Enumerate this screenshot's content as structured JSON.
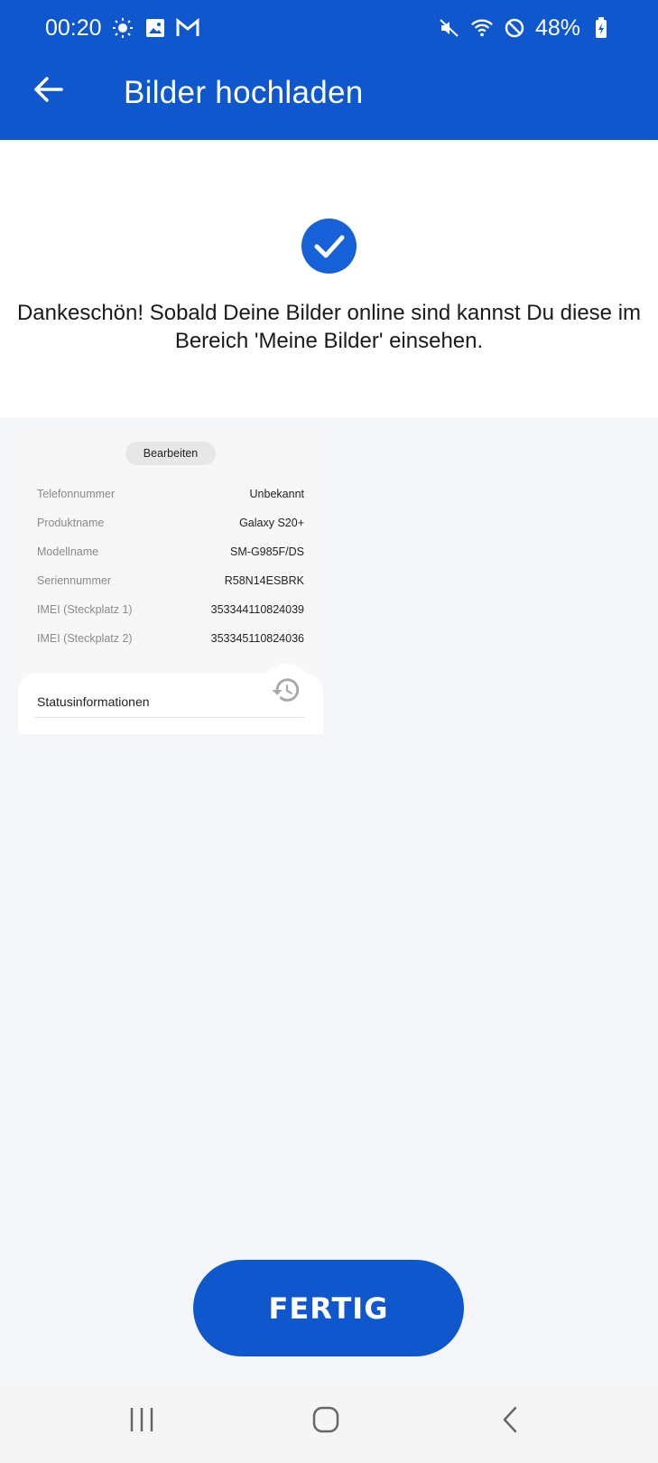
{
  "status_bar": {
    "time": "00:20",
    "battery": "48%",
    "icons": [
      "brightness-icon",
      "image-icon",
      "gmail-icon",
      "mute-icon",
      "wifi-icon",
      "dnd-icon",
      "battery-icon"
    ]
  },
  "header": {
    "title": "Bilder hochladen",
    "back_icon": "arrow-left-icon",
    "background": "#0f57cc"
  },
  "success": {
    "icon": "check-circle-icon",
    "message": "Dankeschön! Sobald Deine Bilder online sind kannst Du diese im Bereich 'Meine Bilder' einsehen."
  },
  "preview": {
    "edit_label": "Bearbeiten",
    "rows": [
      {
        "label": "Telefonnummer",
        "value": "Unbekannt"
      },
      {
        "label": "Produktname",
        "value": "Galaxy S20+"
      },
      {
        "label": "Modellname",
        "value": "SM-G985F/DS"
      },
      {
        "label": "Seriennummer",
        "value": "R58N14ESBRK"
      },
      {
        "label": "IMEI (Steckplatz 1)",
        "value": "353344110824039"
      },
      {
        "label": "IMEI (Steckplatz 2)",
        "value": "353345110824036"
      }
    ],
    "status_label": "Statusinformationen",
    "history_icon": "history-icon"
  },
  "actions": {
    "done_label": "FERTIG"
  },
  "navbar": {
    "items": [
      "recents-icon",
      "home-icon",
      "back-icon"
    ]
  }
}
